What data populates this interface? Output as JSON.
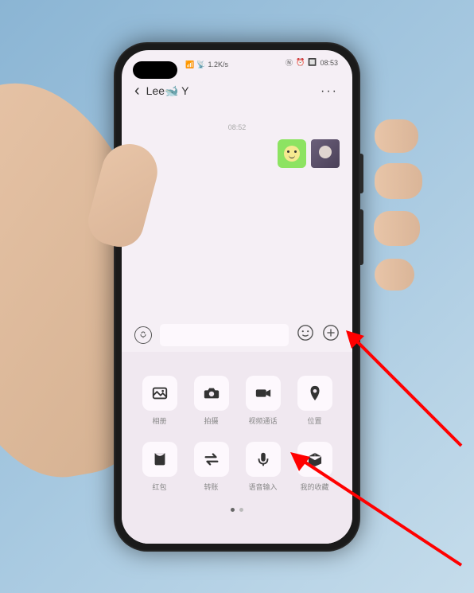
{
  "status_bar": {
    "signal_indicator": "⁴⁶",
    "wifi_indicator": "📶",
    "speed": "1.2K/s",
    "nfc": "N",
    "alarm": "⏰",
    "battery": "🔋",
    "time": "08:53"
  },
  "header": {
    "contact_name": "Lee🐋 Y",
    "more": "···"
  },
  "chat": {
    "timestamp": "08:52"
  },
  "attachment_panel": {
    "items": [
      {
        "label": "相册",
        "icon": "album"
      },
      {
        "label": "拍摄",
        "icon": "camera"
      },
      {
        "label": "视频通话",
        "icon": "video"
      },
      {
        "label": "位置",
        "icon": "location"
      },
      {
        "label": "红包",
        "icon": "redpacket"
      },
      {
        "label": "转账",
        "icon": "transfer"
      },
      {
        "label": "语音输入",
        "icon": "voice"
      },
      {
        "label": "我的收藏",
        "icon": "favorite"
      }
    ]
  }
}
